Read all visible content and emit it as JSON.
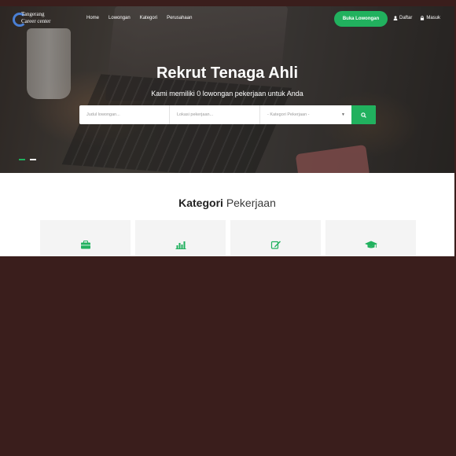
{
  "header": {
    "logo_line1": "Tangerang",
    "logo_line2": "Career center",
    "nav_links": [
      "Home",
      "Lowongan",
      "Kategori",
      "Perusahaan"
    ],
    "post_job_label": "Buka Lowongan",
    "register_label": "Daftar",
    "login_label": "Masuk"
  },
  "hero": {
    "title": "Rekrut Tenaga Ahli",
    "subtitle": "Kami memiliki 0 lowongan pekerjaan untuk Anda"
  },
  "search": {
    "keyword_placeholder": "Judul lowongan...",
    "location_placeholder": "Lokasi pekerjaan...",
    "category_selected": "- Kategori Pekerjaan -",
    "search_icon": "search-icon"
  },
  "categories": {
    "title_main": "Kategori",
    "title_accent": "Pekerjaan",
    "cards": [
      {
        "icon": "briefcase-icon"
      },
      {
        "icon": "bar-chart-icon"
      },
      {
        "icon": "edit-icon"
      },
      {
        "icon": "graduation-cap-icon"
      }
    ]
  },
  "colors": {
    "accent": "#21b15e",
    "backdrop": "#3a1e1c"
  }
}
